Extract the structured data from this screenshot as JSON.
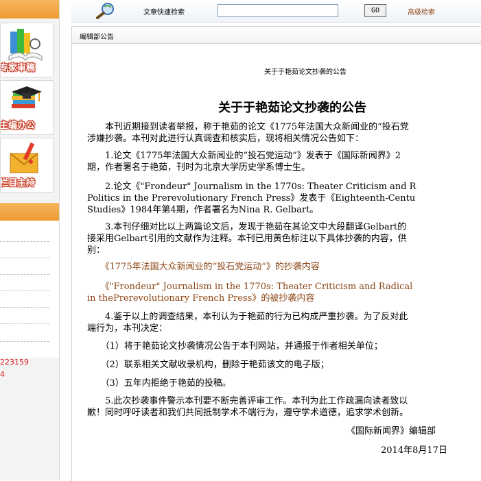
{
  "sidebar": {
    "cards": [
      {
        "label": "专家审稿",
        "icon": "books-reading-icon"
      },
      {
        "label": "主编办公",
        "icon": "graduation-books-icon"
      },
      {
        "label": "栏目主持",
        "icon": "envelope-pencil-icon"
      }
    ],
    "red_texts": [
      "223159",
      "4"
    ]
  },
  "search": {
    "label": "文章快速检索",
    "value": "",
    "go_label": "GO",
    "advanced_label": "高级检索"
  },
  "panel": {
    "header": "编辑部公告",
    "small_title": "关于于艳茹论文抄袭的公告",
    "title": "关于于艳茹论文抄袭的公告",
    "paragraphs": [
      [
        "　　本刊近期接到读者举报，称于艳茹的论文《1775年法国大众新闻业的“投石党",
        "涉嫌抄袭。本刊对此进行认真调查和核实后，现将相关情况公告如下："
      ],
      [
        "　　1.论文《1775年法国大众新闻业的“投石党运动”》发表于《国际新闻界》2",
        "期，作者署名于艳茹，刊时为北京大学历史学系博士生。"
      ],
      [
        "　　2.论文《\"Frondeur\" Journalism in the 1770s: Theater Criticism and R",
        "Politics in the Prerevolutionary French Press》发表于《Eighteenth-Centu",
        "Studies》1984年第4期，作者署名为Nina R. Gelbart。"
      ],
      [
        "　　3.本刊仔细对比以上两篇论文后，发现于艳茹在其论文中大段翻译Gelbart的",
        "接采用Gelbart引用的文献作为注释。本刊已用黄色标注以下具体抄袭的内容，供",
        "别："
      ],
      [
        "　　《1775年法国大众新闻业的“投石党运动”》的抄袭内容"
      ],
      [
        "　　《\"Frondeur\" Journalism in the 1770s: Theater Criticism and Radical",
        "in thePrerevolutionary French Press》的被抄袭内容"
      ],
      [
        "　　4.鉴于以上的调查结果，本刊认为于艳茹的行为已构成严重抄袭。为了反对此",
        "端行为，本刊决定："
      ],
      [
        "　　（1）将于艳茹论文抄袭情况公告于本刊网站，并通报于作者相关单位；"
      ],
      [
        "　　（2）联系相关文献收录机构，删除于艳茹该文的电子版；"
      ],
      [
        "　　（3）五年内拒绝于艳茹的投稿。"
      ],
      [
        "　　5.此次抄袭事件警示本刊要不断完善评审工作。本刊为此工作疏漏向读者致以",
        "歉！同时呼吁读者和我们共同抵制学术不端行为，遵守学术道德，追求学术创新。"
      ]
    ],
    "signature": "《国际新闻界》编辑部",
    "date": "2014年8月17日"
  },
  "colors": {
    "accent_orange": "#ee9a33",
    "link_brown": "#8b4513",
    "red": "#e01818"
  }
}
